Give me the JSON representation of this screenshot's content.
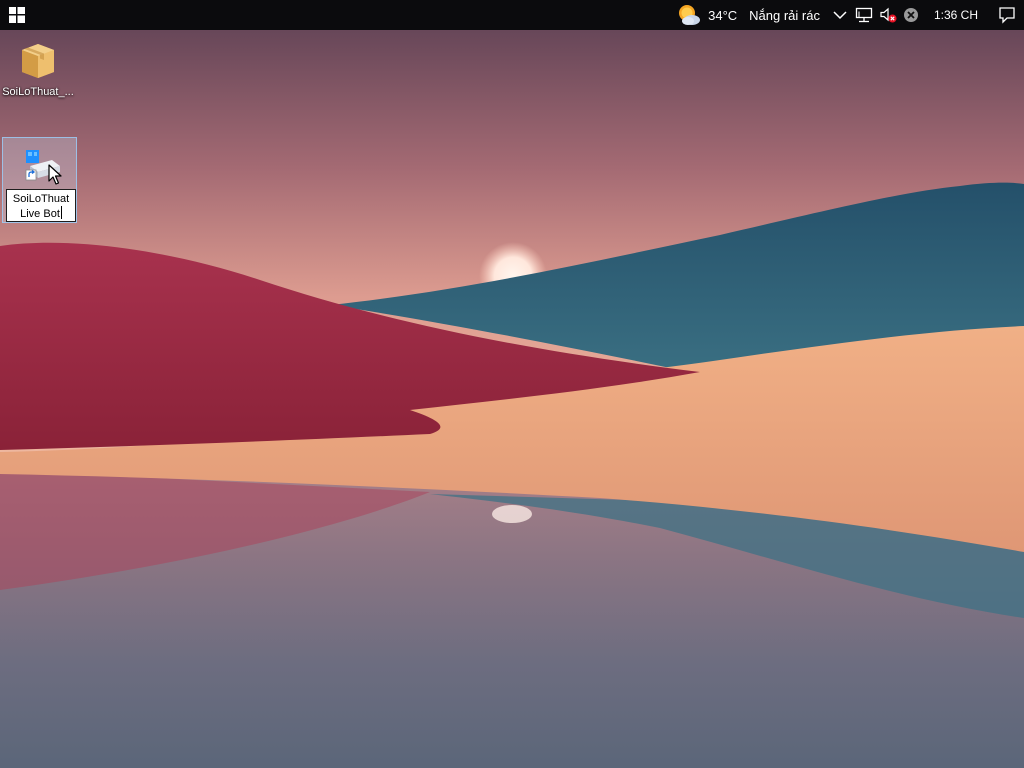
{
  "taskbar": {
    "start_icon": "windows-logo-icon",
    "weather": {
      "icon": "sun-behind-cloud-icon",
      "temperature": "34°C",
      "description": "Nắng rải rác"
    },
    "tray_icons": [
      "chevron-up-icon",
      "network-icon",
      "volume-muted-icon",
      "defender-error-icon"
    ],
    "clock": "1:36 CH",
    "notification_icon": "action-center-icon"
  },
  "desktop": {
    "icons": [
      {
        "label": "SoiLoThuat_...",
        "icon": "package-icon",
        "selected": false
      },
      {
        "label_line1": "SoiLoThuat",
        "label_line2": "Live Bot",
        "icon": "app-shortcut-icon",
        "selected": true,
        "renaming": true
      }
    ]
  },
  "colors": {
    "taskbar_bg": "#0b0b0d",
    "selection_fill": "#cce8ff",
    "selection_border": "#99d1ff"
  }
}
